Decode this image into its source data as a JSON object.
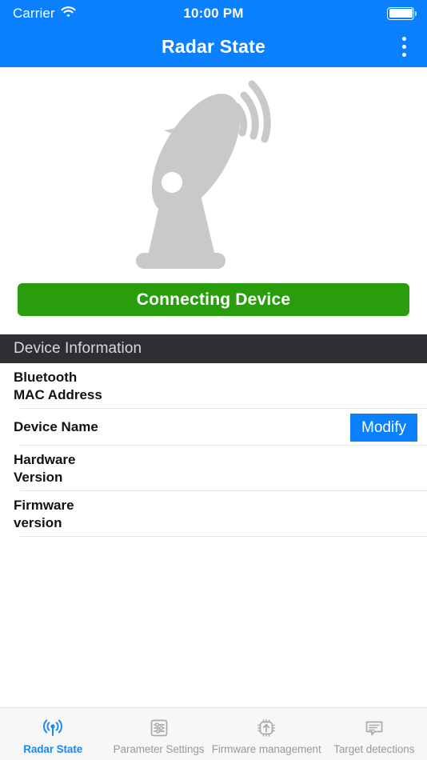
{
  "status_bar": {
    "carrier": "Carrier",
    "wifi_icon": "wifi-icon",
    "time": "10:00 PM",
    "battery_icon": "battery-icon"
  },
  "nav_bar": {
    "title": "Radar State",
    "menu_icon": "more-vertical-icon"
  },
  "hero": {
    "illustration": "satellite-dish-icon"
  },
  "connect": {
    "label": "Connecting Device",
    "color": "#2a9d0c"
  },
  "device_information": {
    "header": "Device Information",
    "rows": [
      {
        "label": "Bluetooth\nMAC Address",
        "value": "",
        "action": ""
      },
      {
        "label": "Device Name",
        "value": "",
        "action": "Modify"
      },
      {
        "label": "Hardware\nVersion",
        "value": "",
        "action": ""
      },
      {
        "label": "Firmware\nversion",
        "value": "",
        "action": ""
      }
    ]
  },
  "tab_bar": {
    "active_color": "#1a88f5",
    "inactive_color": "#9a9a9a",
    "items": [
      {
        "label": "Radar State",
        "icon": "radar-signal-icon",
        "active": true
      },
      {
        "label": "Parameter Settings",
        "icon": "sliders-icon",
        "active": false
      },
      {
        "label": "Firmware management",
        "icon": "chip-upload-icon",
        "active": false
      },
      {
        "label": "Target detections",
        "icon": "speech-bubble-icon",
        "active": false
      }
    ]
  }
}
